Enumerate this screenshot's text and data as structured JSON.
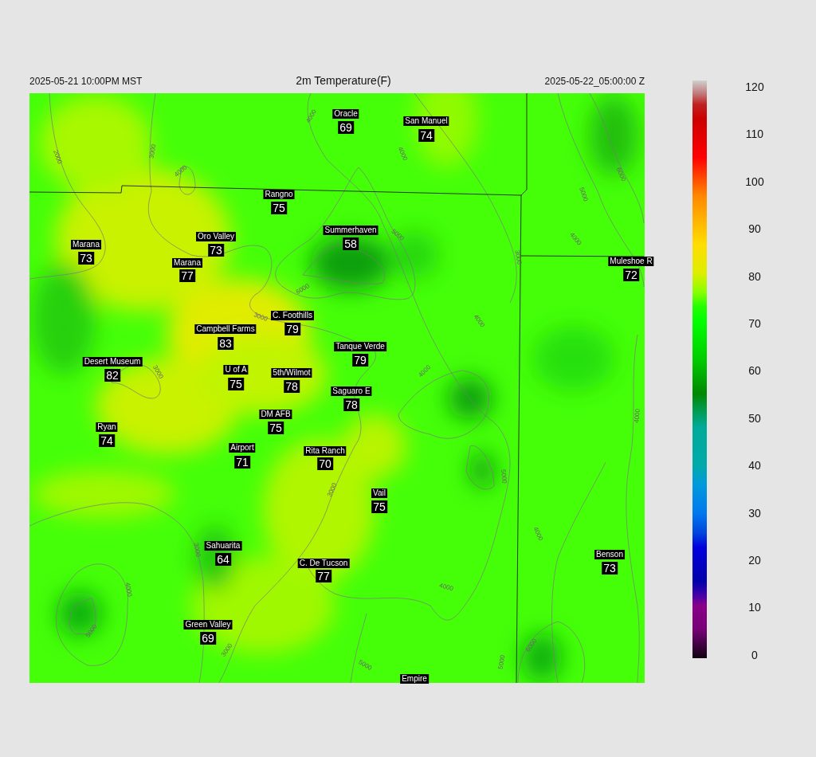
{
  "header": {
    "local_time": "2025-05-21 10:00PM MST",
    "title": "2m Temperature(F)",
    "valid_time": "2025-05-22_05:00:00 Z"
  },
  "stations": [
    {
      "name": "Oracle",
      "value": "69"
    },
    {
      "name": "San Manuel",
      "value": "74"
    },
    {
      "name": "Rangno",
      "value": "75"
    },
    {
      "name": "Summerhaven",
      "value": "58"
    },
    {
      "name": "Marana",
      "value": "73"
    },
    {
      "name": "Oro Valley",
      "value": "73"
    },
    {
      "name": "Marana",
      "value": "77"
    },
    {
      "name": "Muleshoe R",
      "value": "72"
    },
    {
      "name": "C. Foothills",
      "value": "79"
    },
    {
      "name": "Campbell Farms",
      "value": "83"
    },
    {
      "name": "Desert Museum",
      "value": "82"
    },
    {
      "name": "Tanque Verde",
      "value": "79"
    },
    {
      "name": "U of A",
      "value": "75"
    },
    {
      "name": "5th/Wilmot",
      "value": "78"
    },
    {
      "name": "Saguaro E",
      "value": "78"
    },
    {
      "name": "DM AFB",
      "value": "75"
    },
    {
      "name": "Ryan",
      "value": "74"
    },
    {
      "name": "Airport",
      "value": "71"
    },
    {
      "name": "Rita Ranch",
      "value": "70"
    },
    {
      "name": "Vail",
      "value": "75"
    },
    {
      "name": "Sahuarita",
      "value": "64"
    },
    {
      "name": "Benson",
      "value": "73"
    },
    {
      "name": "C. De Tucson",
      "value": "77"
    },
    {
      "name": "Green Valley",
      "value": "69"
    },
    {
      "name": "Empire"
    }
  ],
  "contour_labels": [
    "2000",
    "3000",
    "4000",
    "4000",
    "4000",
    "6000",
    "3000",
    "5000",
    "3000",
    "5000",
    "6000",
    "4000",
    "4000",
    "4000",
    "3000",
    "3000",
    "5000",
    "4000",
    "4000",
    "3000",
    "4000",
    "4000",
    "5000",
    "3000",
    "5000",
    "5000",
    "6000"
  ],
  "colorbar": {
    "ticks": [
      "120",
      "110",
      "100",
      "90",
      "80",
      "70",
      "60",
      "50",
      "40",
      "30",
      "20",
      "10",
      "0"
    ]
  }
}
